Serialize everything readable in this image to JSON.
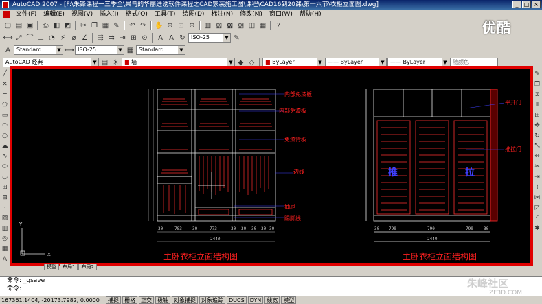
{
  "window": {
    "title": "AutoCAD 2007 - [F:\\朱锋课程一三季全\\果鸟的华丽进诱软件课程之CAD家装施工图\\课程\\CAD16到20课\\第十六节\\衣柜立面图.dwg]",
    "controls": [
      "_",
      "□",
      "×"
    ]
  },
  "menu": [
    "文件(F)",
    "编辑(E)",
    "视图(V)",
    "插入(I)",
    "格式(O)",
    "工具(T)",
    "绘图(D)",
    "标注(N)",
    "修改(M)",
    "窗口(W)",
    "帮助(H)"
  ],
  "toolbar": {
    "dimstyle_value": "ISO-25",
    "text_style": "Standard",
    "dim_style": "ISO-25",
    "table_style": "Standard",
    "workspace": "AutoCAD 经典",
    "layer_name": "墙",
    "color": "ByLayer",
    "linetype": "ByLayer",
    "lineweight": "ByLayer",
    "plot_style": "随颜色"
  },
  "drawing": {
    "left_title": "主卧衣柜立面结构图",
    "right_title": "主卧衣柜立面结构图",
    "labels_left": [
      "内部免漆板",
      "内部免漆板",
      "免漆背板",
      "边线",
      "抽屉",
      "踢脚线"
    ],
    "labels_right": [
      "平开门",
      "推拉门"
    ],
    "door_text": [
      "推",
      "拉"
    ],
    "dims_left_bottom": [
      "30",
      "783",
      "30",
      "773",
      "30",
      "30",
      "30",
      "30",
      "30"
    ],
    "dim_left_total": "2440",
    "dims_right_bottom": [
      "30",
      "790",
      "790",
      "790",
      "30"
    ],
    "dim_right_total": "2440"
  },
  "layout_tabs": [
    "模型",
    "布局1",
    "布局2"
  ],
  "command": {
    "line1": "命令: _qsave",
    "line2": "命令:"
  },
  "status": {
    "coords": "167361.1404, -20173.7982, 0.0000",
    "buttons": [
      "捕捉",
      "栅格",
      "正交",
      "极轴",
      "对象捕捉",
      "对象追踪",
      "DUCS",
      "DYN",
      "线宽",
      "模型"
    ]
  },
  "watermarks": {
    "top": "优酷",
    "bottom": "朱峰社区",
    "bottom_sub": "ZF3D.COM"
  },
  "colors": {
    "canvas_border": "#e00000",
    "canvas_bg": "#000000",
    "annotation_red": "#ff2020",
    "leader_blue": "#4040ff"
  }
}
